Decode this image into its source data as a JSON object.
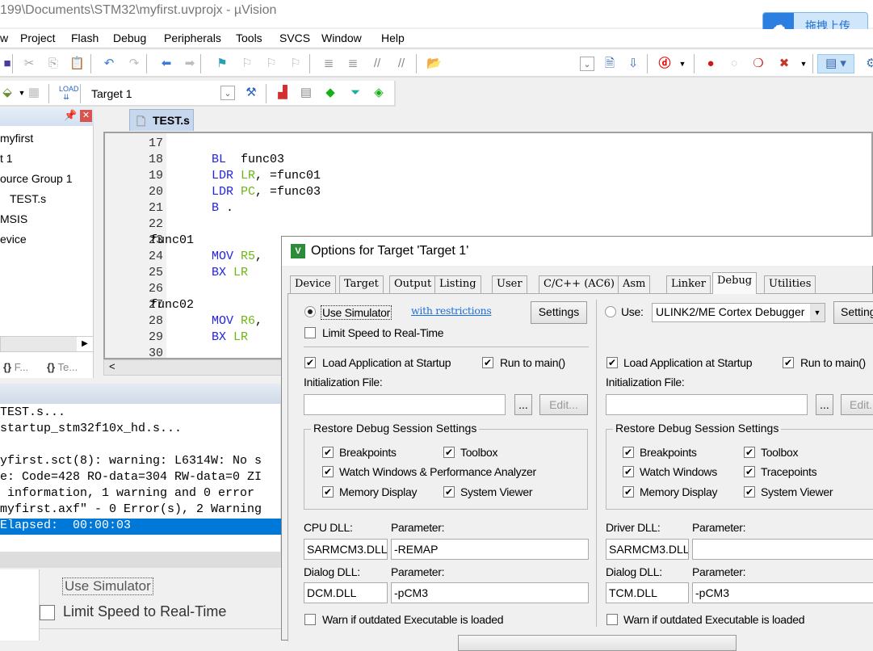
{
  "window": {
    "title": "199\\Documents\\STM32\\myfirst.uvprojx - µVision"
  },
  "upload_button": {
    "label": "拖拽上传",
    "icon": "cloud-icon"
  },
  "menu": [
    "w",
    "Project",
    "Flash",
    "Debug",
    "Peripherals",
    "Tools",
    "SVCS",
    "Window",
    "Help"
  ],
  "toolbar2": {
    "target": "Target 1"
  },
  "project_panel": {
    "items": [
      "myfirst",
      "t 1",
      "ource Group 1",
      "TEST.s",
      "MSIS",
      "evice"
    ],
    "tabs": [
      "F...",
      "Te..."
    ]
  },
  "editor": {
    "tab": "TEST.s",
    "lines": [
      {
        "n": "17",
        "label": "",
        "op": "",
        "reg": "",
        "rest": ""
      },
      {
        "n": "18",
        "label": "",
        "op": "BL",
        "reg": "",
        "rest": "  func03"
      },
      {
        "n": "19",
        "label": "",
        "op": "LDR",
        "reg": " LR",
        "rest": ", =func01"
      },
      {
        "n": "20",
        "label": "",
        "op": "LDR",
        "reg": " PC",
        "rest": ", =func03"
      },
      {
        "n": "21",
        "label": "",
        "op": "B",
        "reg": "",
        "rest": " ."
      },
      {
        "n": "22",
        "label": "",
        "op": "",
        "reg": "",
        "rest": ""
      },
      {
        "n": "23",
        "label": "func01",
        "op": "",
        "reg": "",
        "rest": ""
      },
      {
        "n": "24",
        "label": "",
        "op": "MOV",
        "reg": " R5",
        "rest": ","
      },
      {
        "n": "25",
        "label": "",
        "op": "BX",
        "reg": " LR",
        "rest": ""
      },
      {
        "n": "26",
        "label": "",
        "op": "",
        "reg": "",
        "rest": ""
      },
      {
        "n": "27",
        "label": "func02",
        "op": "",
        "reg": "",
        "rest": ""
      },
      {
        "n": "28",
        "label": "",
        "op": "MOV",
        "reg": " R6",
        "rest": ","
      },
      {
        "n": "29",
        "label": "",
        "op": "BX",
        "reg": " LR",
        "rest": ""
      },
      {
        "n": "30",
        "label": "",
        "op": "",
        "reg": "",
        "rest": ""
      }
    ]
  },
  "build_output": {
    "lines": [
      "TEST.s...",
      "startup_stm32f10x_hd.s...",
      "",
      "yfirst.sct(8): warning: L6314W: No s",
      "e: Code=428 RO-data=304 RW-data=0 ZI",
      " information, 1 warning and 0 error",
      "myfirst.axf\" - 0 Error(s), 2 Warning",
      "Elapsed:  00:00:03"
    ],
    "selected_index": 7
  },
  "background_dialog": {
    "use_simulator": "Use Simulator",
    "limit_speed": "Limit Speed to Real-Time"
  },
  "dialog": {
    "title": "Options for Target 'Target 1'",
    "tabs": [
      "Device",
      "Target",
      "Output",
      "Listing",
      "User",
      "C/C++ (AC6)",
      "Asm",
      "Linker",
      "Debug",
      "Utilities"
    ],
    "active_tab": "Debug",
    "left": {
      "use_simulator": "Use Simulator",
      "use_simulator_selected": true,
      "restrictions_link": "with restrictions",
      "settings": "Settings",
      "limit_speed": "Limit Speed to Real-Time",
      "limit_speed_checked": false,
      "load_app": "Load Application at Startup",
      "run_to_main": "Run to main()",
      "init_file_label": "Initialization File:",
      "init_file": "",
      "browse": "...",
      "edit": "Edit...",
      "restore_group": "Restore Debug Session Settings",
      "restore": [
        {
          "label": "Breakpoints",
          "checked": true
        },
        {
          "label": "Toolbox",
          "checked": true
        },
        {
          "label": "Watch Windows & Performance Analyzer",
          "checked": true
        },
        {
          "label": "Memory Display",
          "checked": true
        },
        {
          "label": "System Viewer",
          "checked": true
        }
      ],
      "dll_label": "CPU DLL:",
      "param_label": "Parameter:",
      "dll": "SARMCM3.DLL",
      "dll_param": "-REMAP",
      "dialog_dll_label": "Dialog DLL:",
      "dialog_dll": "DCM.DLL",
      "dialog_param": "-pCM3",
      "warn": "Warn if outdated Executable is loaded"
    },
    "right": {
      "use": "Use:",
      "use_selected": false,
      "debugger": "ULINK2/ME Cortex Debugger",
      "settings": "Settings",
      "load_app": "Load Application at Startup",
      "run_to_main": "Run to main()",
      "init_file_label": "Initialization File:",
      "init_file": "",
      "browse": "...",
      "edit": "Edit...",
      "restore_group": "Restore Debug Session Settings",
      "restore": [
        {
          "label": "Breakpoints",
          "checked": true
        },
        {
          "label": "Toolbox",
          "checked": true
        },
        {
          "label": "Watch Windows",
          "checked": true
        },
        {
          "label": "Tracepoints",
          "checked": true
        },
        {
          "label": "Memory Display",
          "checked": true
        },
        {
          "label": "System Viewer",
          "checked": true
        }
      ],
      "dll_label": "Driver DLL:",
      "param_label": "Parameter:",
      "dll": "SARMCM3.DLL",
      "dll_param": "",
      "dialog_dll_label": "Dialog DLL:",
      "dialog_dll": "TCM.DLL",
      "dialog_param": "-pCM3",
      "warn": "Warn if outdated Executable is loaded"
    }
  }
}
